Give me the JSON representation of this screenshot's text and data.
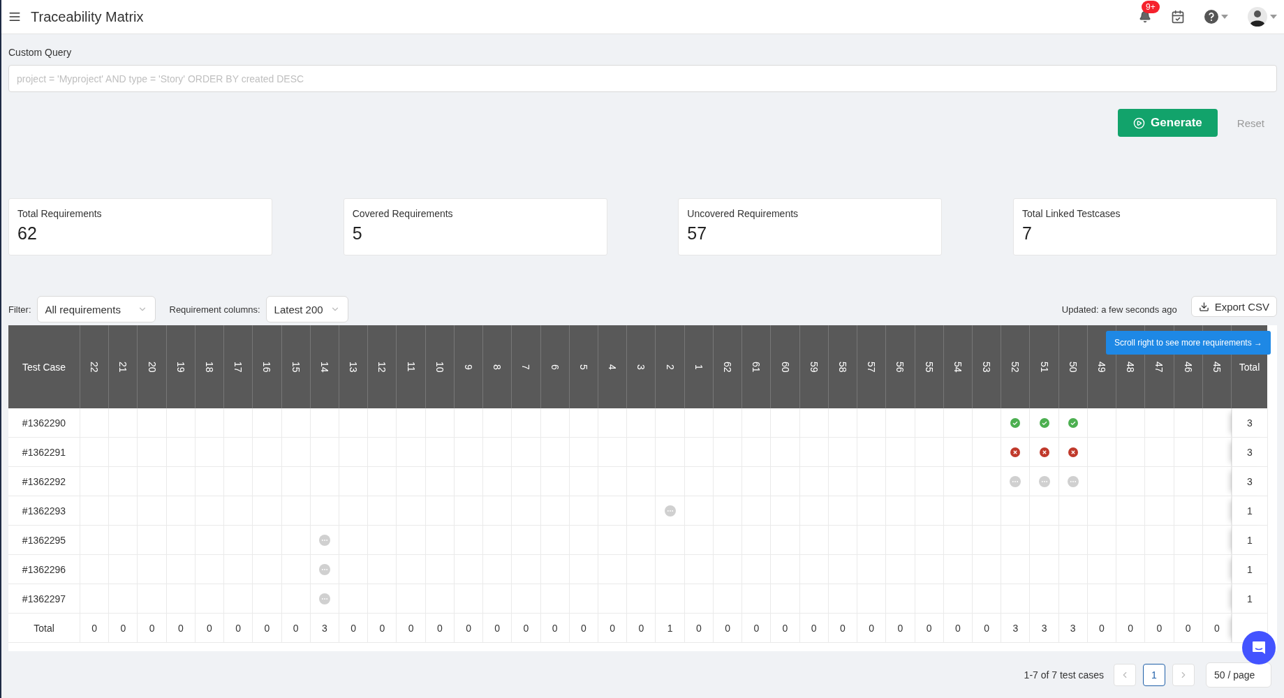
{
  "header": {
    "title": "Traceability Matrix",
    "notification_badge": "9+"
  },
  "query": {
    "label": "Custom Query",
    "placeholder": "project = 'Myproject' AND type = 'Story' ORDER BY created DESC"
  },
  "actions": {
    "generate": "Generate",
    "reset": "Reset"
  },
  "stats": [
    {
      "label": "Total Requirements",
      "value": "62"
    },
    {
      "label": "Covered Requirements",
      "value": "5"
    },
    {
      "label": "Uncovered Requirements",
      "value": "57"
    },
    {
      "label": "Total Linked Testcases",
      "value": "7"
    }
  ],
  "filters": {
    "filter_label": "Filter:",
    "filter_value": "All requirements",
    "columns_label": "Requirement columns:",
    "columns_value": "Latest 200"
  },
  "updated": "Updated: a few seconds ago",
  "export": "Export CSV",
  "matrix": {
    "first_column": "Test Case",
    "total_column": "Total",
    "scroll_hint": "Scroll right to see more requirements →",
    "columns": [
      "22",
      "21",
      "20",
      "19",
      "18",
      "17",
      "16",
      "15",
      "14",
      "13",
      "12",
      "11",
      "10",
      "9",
      "8",
      "7",
      "6",
      "5",
      "4",
      "3",
      "2",
      "1",
      "62",
      "61",
      "60",
      "59",
      "58",
      "57",
      "56",
      "55",
      "54",
      "53",
      "52",
      "51",
      "50",
      "49",
      "48",
      "47",
      "46",
      "45"
    ],
    "rows": [
      {
        "test_case": "#1362290",
        "total": "3",
        "cells": [
          {
            "kind": "empty"
          },
          {
            "kind": "empty"
          },
          {
            "kind": "empty"
          },
          {
            "kind": "empty"
          },
          {
            "kind": "empty"
          },
          {
            "kind": "empty"
          },
          {
            "kind": "empty"
          },
          {
            "kind": "empty"
          },
          {
            "kind": "empty"
          },
          {
            "kind": "empty"
          },
          {
            "kind": "empty"
          },
          {
            "kind": "empty"
          },
          {
            "kind": "empty"
          },
          {
            "kind": "empty"
          },
          {
            "kind": "empty"
          },
          {
            "kind": "empty"
          },
          {
            "kind": "empty"
          },
          {
            "kind": "empty"
          },
          {
            "kind": "empty"
          },
          {
            "kind": "empty"
          },
          {
            "kind": "empty"
          },
          {
            "kind": "empty"
          },
          {
            "kind": "empty"
          },
          {
            "kind": "empty"
          },
          {
            "kind": "empty"
          },
          {
            "kind": "empty"
          },
          {
            "kind": "empty"
          },
          {
            "kind": "empty"
          },
          {
            "kind": "empty"
          },
          {
            "kind": "empty"
          },
          {
            "kind": "empty"
          },
          {
            "kind": "empty"
          },
          {
            "kind": "pass"
          },
          {
            "kind": "pass"
          },
          {
            "kind": "pass"
          },
          {
            "kind": "empty"
          },
          {
            "kind": "empty"
          },
          {
            "kind": "empty"
          },
          {
            "kind": "empty"
          },
          {
            "kind": "empty"
          }
        ]
      },
      {
        "test_case": "#1362291",
        "total": "3",
        "cells": [
          {
            "kind": "empty"
          },
          {
            "kind": "empty"
          },
          {
            "kind": "empty"
          },
          {
            "kind": "empty"
          },
          {
            "kind": "empty"
          },
          {
            "kind": "empty"
          },
          {
            "kind": "empty"
          },
          {
            "kind": "empty"
          },
          {
            "kind": "empty"
          },
          {
            "kind": "empty"
          },
          {
            "kind": "empty"
          },
          {
            "kind": "empty"
          },
          {
            "kind": "empty"
          },
          {
            "kind": "empty"
          },
          {
            "kind": "empty"
          },
          {
            "kind": "empty"
          },
          {
            "kind": "empty"
          },
          {
            "kind": "empty"
          },
          {
            "kind": "empty"
          },
          {
            "kind": "empty"
          },
          {
            "kind": "empty"
          },
          {
            "kind": "empty"
          },
          {
            "kind": "empty"
          },
          {
            "kind": "empty"
          },
          {
            "kind": "empty"
          },
          {
            "kind": "empty"
          },
          {
            "kind": "empty"
          },
          {
            "kind": "empty"
          },
          {
            "kind": "empty"
          },
          {
            "kind": "empty"
          },
          {
            "kind": "empty"
          },
          {
            "kind": "empty"
          },
          {
            "kind": "fail"
          },
          {
            "kind": "fail"
          },
          {
            "kind": "fail"
          },
          {
            "kind": "empty"
          },
          {
            "kind": "empty"
          },
          {
            "kind": "empty"
          },
          {
            "kind": "empty"
          },
          {
            "kind": "empty"
          }
        ]
      },
      {
        "test_case": "#1362292",
        "total": "3",
        "cells": [
          {
            "kind": "empty"
          },
          {
            "kind": "empty"
          },
          {
            "kind": "empty"
          },
          {
            "kind": "empty"
          },
          {
            "kind": "empty"
          },
          {
            "kind": "empty"
          },
          {
            "kind": "empty"
          },
          {
            "kind": "empty"
          },
          {
            "kind": "empty"
          },
          {
            "kind": "empty"
          },
          {
            "kind": "empty"
          },
          {
            "kind": "empty"
          },
          {
            "kind": "empty"
          },
          {
            "kind": "empty"
          },
          {
            "kind": "empty"
          },
          {
            "kind": "empty"
          },
          {
            "kind": "empty"
          },
          {
            "kind": "empty"
          },
          {
            "kind": "empty"
          },
          {
            "kind": "empty"
          },
          {
            "kind": "empty"
          },
          {
            "kind": "empty"
          },
          {
            "kind": "empty"
          },
          {
            "kind": "empty"
          },
          {
            "kind": "empty"
          },
          {
            "kind": "empty"
          },
          {
            "kind": "empty"
          },
          {
            "kind": "empty"
          },
          {
            "kind": "empty"
          },
          {
            "kind": "empty"
          },
          {
            "kind": "empty"
          },
          {
            "kind": "empty"
          },
          {
            "kind": "pending"
          },
          {
            "kind": "pending"
          },
          {
            "kind": "pending"
          },
          {
            "kind": "empty"
          },
          {
            "kind": "empty"
          },
          {
            "kind": "empty"
          },
          {
            "kind": "empty"
          },
          {
            "kind": "empty"
          }
        ]
      },
      {
        "test_case": "#1362293",
        "total": "1",
        "cells": [
          {
            "kind": "empty"
          },
          {
            "kind": "empty"
          },
          {
            "kind": "empty"
          },
          {
            "kind": "empty"
          },
          {
            "kind": "empty"
          },
          {
            "kind": "empty"
          },
          {
            "kind": "empty"
          },
          {
            "kind": "empty"
          },
          {
            "kind": "empty"
          },
          {
            "kind": "empty"
          },
          {
            "kind": "empty"
          },
          {
            "kind": "empty"
          },
          {
            "kind": "empty"
          },
          {
            "kind": "empty"
          },
          {
            "kind": "empty"
          },
          {
            "kind": "empty"
          },
          {
            "kind": "empty"
          },
          {
            "kind": "empty"
          },
          {
            "kind": "empty"
          },
          {
            "kind": "empty"
          },
          {
            "kind": "pending"
          },
          {
            "kind": "empty"
          },
          {
            "kind": "empty"
          },
          {
            "kind": "empty"
          },
          {
            "kind": "empty"
          },
          {
            "kind": "empty"
          },
          {
            "kind": "empty"
          },
          {
            "kind": "empty"
          },
          {
            "kind": "empty"
          },
          {
            "kind": "empty"
          },
          {
            "kind": "empty"
          },
          {
            "kind": "empty"
          },
          {
            "kind": "empty"
          },
          {
            "kind": "empty"
          },
          {
            "kind": "empty"
          },
          {
            "kind": "empty"
          },
          {
            "kind": "empty"
          },
          {
            "kind": "empty"
          },
          {
            "kind": "empty"
          },
          {
            "kind": "empty"
          }
        ]
      },
      {
        "test_case": "#1362295",
        "total": "1",
        "cells": [
          {
            "kind": "empty"
          },
          {
            "kind": "empty"
          },
          {
            "kind": "empty"
          },
          {
            "kind": "empty"
          },
          {
            "kind": "empty"
          },
          {
            "kind": "empty"
          },
          {
            "kind": "empty"
          },
          {
            "kind": "empty"
          },
          {
            "kind": "pending"
          },
          {
            "kind": "empty"
          },
          {
            "kind": "empty"
          },
          {
            "kind": "empty"
          },
          {
            "kind": "empty"
          },
          {
            "kind": "empty"
          },
          {
            "kind": "empty"
          },
          {
            "kind": "empty"
          },
          {
            "kind": "empty"
          },
          {
            "kind": "empty"
          },
          {
            "kind": "empty"
          },
          {
            "kind": "empty"
          },
          {
            "kind": "empty"
          },
          {
            "kind": "empty"
          },
          {
            "kind": "empty"
          },
          {
            "kind": "empty"
          },
          {
            "kind": "empty"
          },
          {
            "kind": "empty"
          },
          {
            "kind": "empty"
          },
          {
            "kind": "empty"
          },
          {
            "kind": "empty"
          },
          {
            "kind": "empty"
          },
          {
            "kind": "empty"
          },
          {
            "kind": "empty"
          },
          {
            "kind": "empty"
          },
          {
            "kind": "empty"
          },
          {
            "kind": "empty"
          },
          {
            "kind": "empty"
          },
          {
            "kind": "empty"
          },
          {
            "kind": "empty"
          },
          {
            "kind": "empty"
          },
          {
            "kind": "empty"
          }
        ]
      },
      {
        "test_case": "#1362296",
        "total": "1",
        "cells": [
          {
            "kind": "empty"
          },
          {
            "kind": "empty"
          },
          {
            "kind": "empty"
          },
          {
            "kind": "empty"
          },
          {
            "kind": "empty"
          },
          {
            "kind": "empty"
          },
          {
            "kind": "empty"
          },
          {
            "kind": "empty"
          },
          {
            "kind": "pending"
          },
          {
            "kind": "empty"
          },
          {
            "kind": "empty"
          },
          {
            "kind": "empty"
          },
          {
            "kind": "empty"
          },
          {
            "kind": "empty"
          },
          {
            "kind": "empty"
          },
          {
            "kind": "empty"
          },
          {
            "kind": "empty"
          },
          {
            "kind": "empty"
          },
          {
            "kind": "empty"
          },
          {
            "kind": "empty"
          },
          {
            "kind": "empty"
          },
          {
            "kind": "empty"
          },
          {
            "kind": "empty"
          },
          {
            "kind": "empty"
          },
          {
            "kind": "empty"
          },
          {
            "kind": "empty"
          },
          {
            "kind": "empty"
          },
          {
            "kind": "empty"
          },
          {
            "kind": "empty"
          },
          {
            "kind": "empty"
          },
          {
            "kind": "empty"
          },
          {
            "kind": "empty"
          },
          {
            "kind": "empty"
          },
          {
            "kind": "empty"
          },
          {
            "kind": "empty"
          },
          {
            "kind": "empty"
          },
          {
            "kind": "empty"
          },
          {
            "kind": "empty"
          },
          {
            "kind": "empty"
          },
          {
            "kind": "empty"
          }
        ]
      },
      {
        "test_case": "#1362297",
        "total": "1",
        "cells": [
          {
            "kind": "empty"
          },
          {
            "kind": "empty"
          },
          {
            "kind": "empty"
          },
          {
            "kind": "empty"
          },
          {
            "kind": "empty"
          },
          {
            "kind": "empty"
          },
          {
            "kind": "empty"
          },
          {
            "kind": "empty"
          },
          {
            "kind": "pending"
          },
          {
            "kind": "empty"
          },
          {
            "kind": "empty"
          },
          {
            "kind": "empty"
          },
          {
            "kind": "empty"
          },
          {
            "kind": "empty"
          },
          {
            "kind": "empty"
          },
          {
            "kind": "empty"
          },
          {
            "kind": "empty"
          },
          {
            "kind": "empty"
          },
          {
            "kind": "empty"
          },
          {
            "kind": "empty"
          },
          {
            "kind": "empty"
          },
          {
            "kind": "empty"
          },
          {
            "kind": "empty"
          },
          {
            "kind": "empty"
          },
          {
            "kind": "empty"
          },
          {
            "kind": "empty"
          },
          {
            "kind": "empty"
          },
          {
            "kind": "empty"
          },
          {
            "kind": "empty"
          },
          {
            "kind": "empty"
          },
          {
            "kind": "empty"
          },
          {
            "kind": "empty"
          },
          {
            "kind": "empty"
          },
          {
            "kind": "empty"
          },
          {
            "kind": "empty"
          },
          {
            "kind": "empty"
          },
          {
            "kind": "empty"
          },
          {
            "kind": "empty"
          },
          {
            "kind": "empty"
          },
          {
            "kind": "empty"
          }
        ]
      }
    ],
    "totals": {
      "label": "Total",
      "values": [
        "0",
        "0",
        "0",
        "0",
        "0",
        "0",
        "0",
        "0",
        "3",
        "0",
        "0",
        "0",
        "0",
        "0",
        "0",
        "0",
        "0",
        "0",
        "0",
        "0",
        "1",
        "0",
        "0",
        "0",
        "0",
        "0",
        "0",
        "0",
        "0",
        "0",
        "0",
        "0",
        "3",
        "3",
        "3",
        "0",
        "0",
        "0",
        "0",
        "0"
      ]
    }
  },
  "pagination": {
    "summary": "1-7 of 7 test cases",
    "pages": [
      {
        "label": "1",
        "selected": true
      }
    ],
    "page_size": "50 / page"
  }
}
